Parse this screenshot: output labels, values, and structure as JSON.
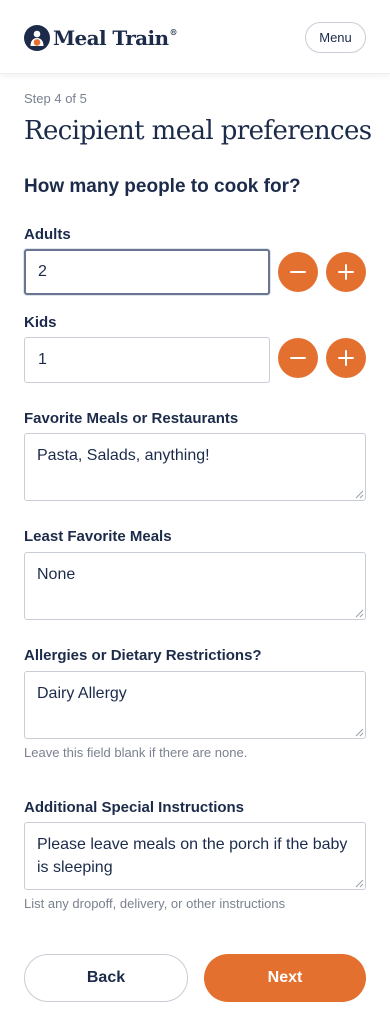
{
  "header": {
    "brand": "Meal Train",
    "brand_mark": "®",
    "menu_label": "Menu"
  },
  "step": "Step 4 of 5",
  "title": "Recipient meal preferences",
  "subtitle": "How many people to cook for?",
  "adults": {
    "label": "Adults",
    "value": "2"
  },
  "kids": {
    "label": "Kids",
    "value": "1"
  },
  "favorite_meals": {
    "label": "Favorite Meals or Restaurants",
    "value": "Pasta, Salads, anything!"
  },
  "least_favorite": {
    "label": "Least Favorite Meals",
    "value": "None"
  },
  "allergies": {
    "label": "Allergies or Dietary Restrictions?",
    "value": "Dairy Allergy",
    "hint": "Leave this field blank if there are none."
  },
  "instructions": {
    "label": "Additional Special Instructions",
    "value": "Please leave meals on the porch if the baby is sleeping",
    "hint": "List any dropoff, delivery, or other instructions"
  },
  "footer": {
    "back_label": "Back",
    "next_label": "Next"
  },
  "icons": {
    "logo": "meal-train-logo-icon",
    "decrement": "minus-icon",
    "increment": "plus-icon"
  },
  "colors": {
    "accent": "#e4702f",
    "navy": "#1c2b4a",
    "muted": "#7b8190",
    "border": "#c9cdd6"
  }
}
